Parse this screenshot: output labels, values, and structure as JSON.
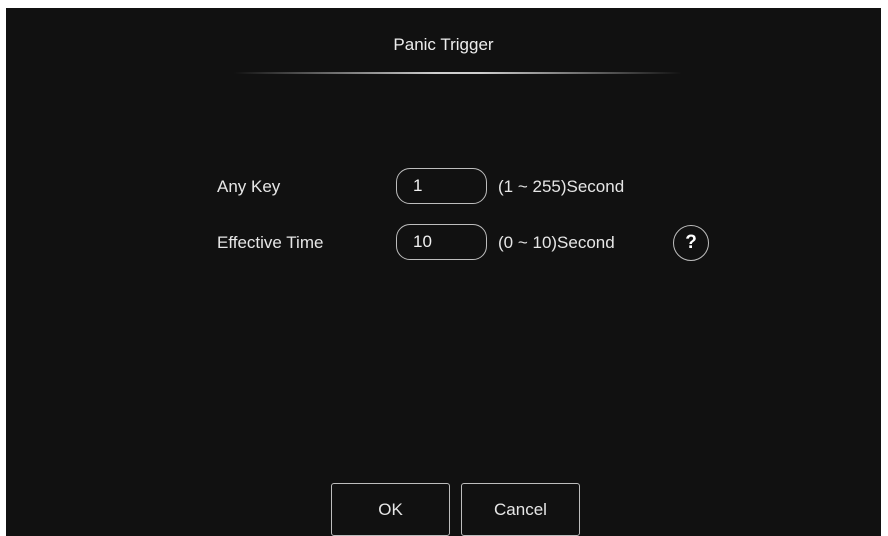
{
  "dialog": {
    "title": "Panic Trigger"
  },
  "fields": {
    "any_key": {
      "label": "Any Key",
      "value": "1",
      "range": "(1 ~ 255)Second"
    },
    "effective_time": {
      "label": "Effective Time",
      "value": "10",
      "range": "(0 ~ 10)Second"
    }
  },
  "help": {
    "icon": "question-mark-icon",
    "glyph": "?"
  },
  "buttons": {
    "ok_label": "OK",
    "cancel_label": "Cancel"
  },
  "colors": {
    "background": "#111111",
    "border": "#bdbdbd",
    "text": "#e6e6e6"
  }
}
